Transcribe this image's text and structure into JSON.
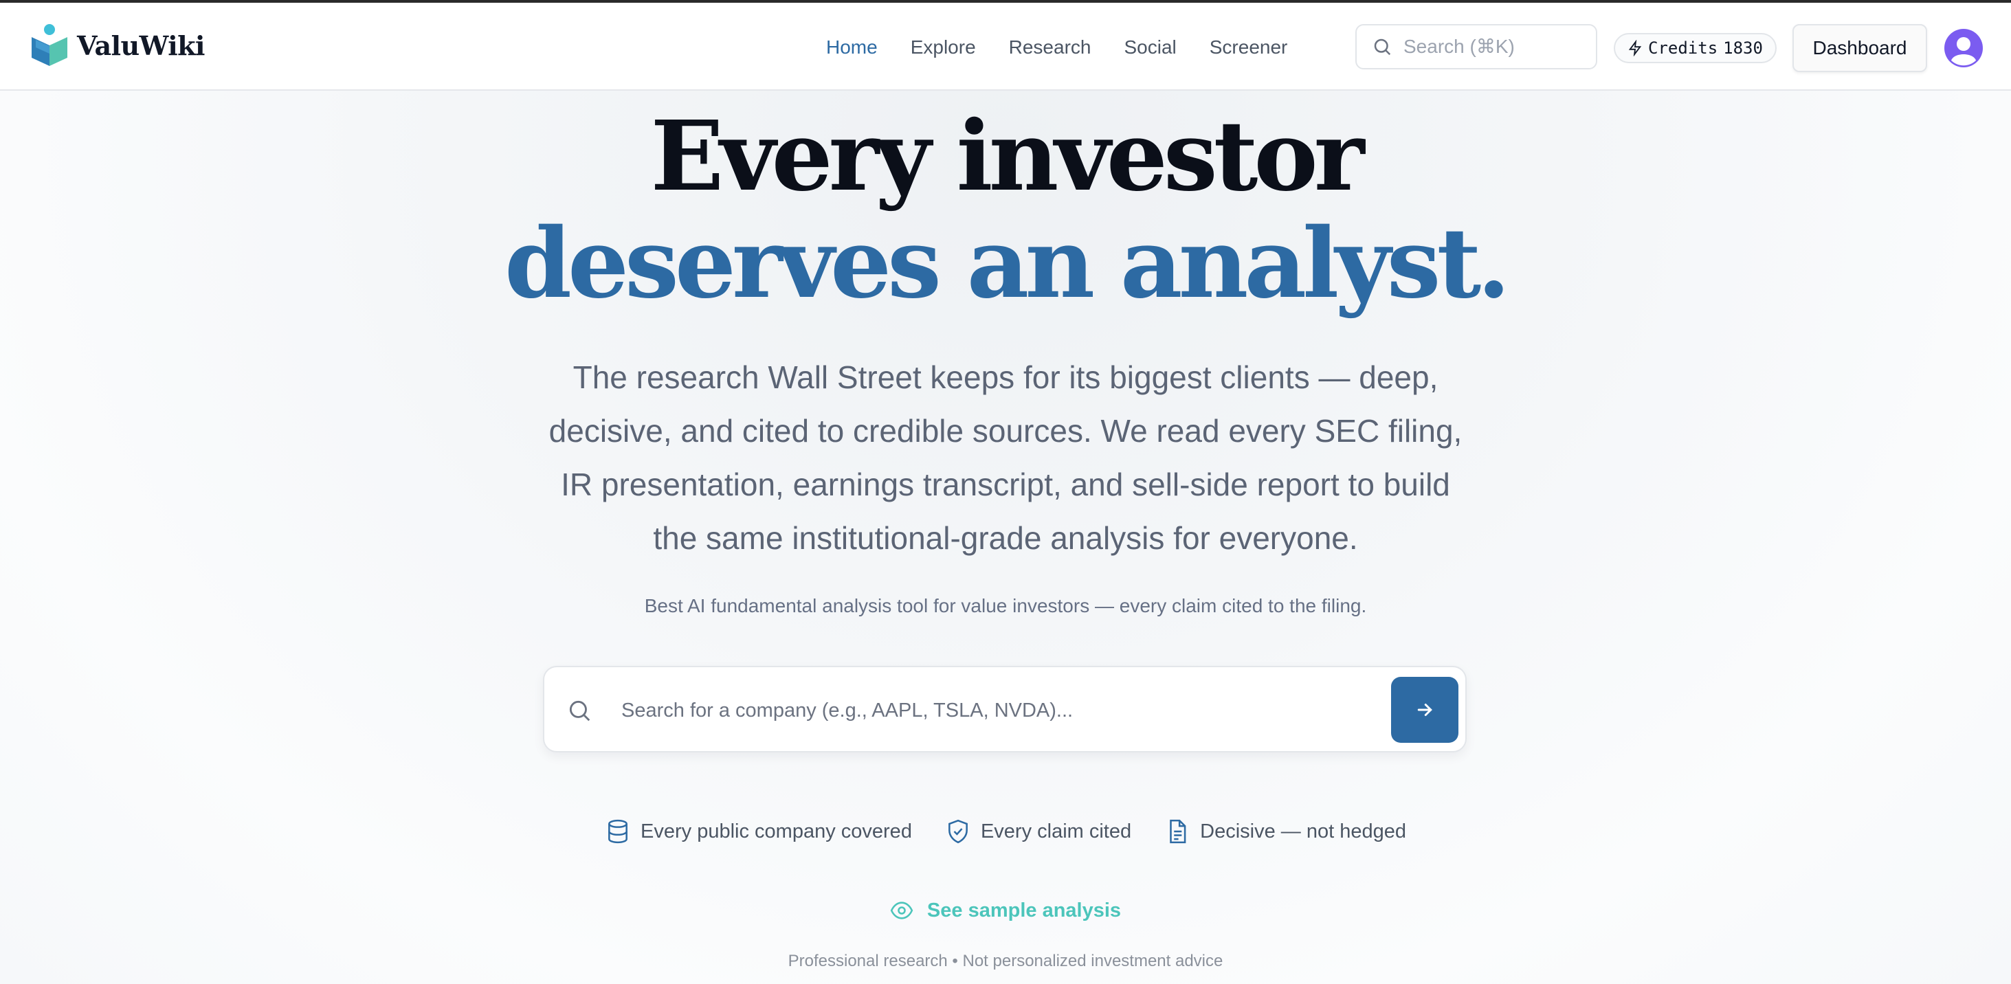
{
  "brand": {
    "name": "ValuWiki"
  },
  "nav": {
    "items": [
      {
        "label": "Home",
        "active": true
      },
      {
        "label": "Explore",
        "active": false
      },
      {
        "label": "Research",
        "active": false
      },
      {
        "label": "Social",
        "active": false
      },
      {
        "label": "Screener",
        "active": false
      }
    ]
  },
  "header": {
    "search_placeholder": "Search (⌘K)",
    "credits_label": "Credits",
    "credits_value": "1830",
    "dashboard_label": "Dashboard"
  },
  "hero": {
    "headline_line1": "Every investor",
    "headline_line2": "deserves an analyst.",
    "subtitle": "The research Wall Street keeps for its biggest clients — deep, decisive, and cited to credible sources. We read every SEC filing, IR presentation, earnings transcript, and sell-side report to build the same institutional-grade analysis for everyone.",
    "tagline": "Best AI fundamental analysis tool for value investors — every claim cited to the filing."
  },
  "search": {
    "placeholder": "Search for a company (e.g., AAPL, TSLA, NVDA)..."
  },
  "features": [
    {
      "label": "Every public company covered",
      "icon": "database-icon"
    },
    {
      "label": "Every claim cited",
      "icon": "shield-check-icon"
    },
    {
      "label": "Decisive — not hedged",
      "icon": "document-icon"
    }
  ],
  "sample_link": "See sample analysis",
  "disclaimer": "Professional research • Not personalized investment advice",
  "colors": {
    "accent": "#2d6aa3",
    "teal": "#4cc5bb",
    "heading": "#0b0f19",
    "avatar": "#7b5cf0"
  }
}
